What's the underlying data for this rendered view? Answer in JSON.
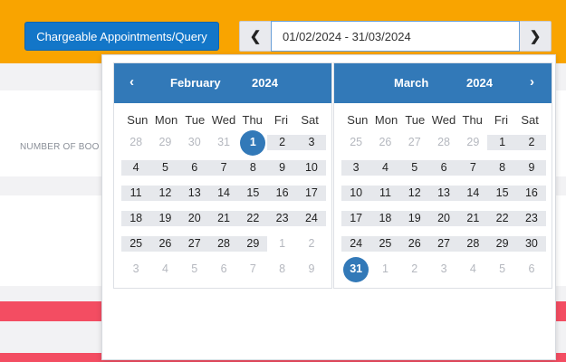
{
  "header": {
    "query_button": "Chargeable Appointments/Query",
    "date_range_value": "01/02/2024 - 31/03/2024",
    "prev_icon": "chevron-left-icon",
    "next_icon": "chevron-right-icon"
  },
  "background": {
    "column_label": "NUMBER OF BOO"
  },
  "colors": {
    "topbar": "#f9a400",
    "primary": "#1376c8",
    "calendar_header": "#3279b8",
    "range_fill": "#e6e8ec",
    "alert_bar": "#f34d62"
  },
  "calendar": {
    "weekdays": [
      "Sun",
      "Mon",
      "Tue",
      "Wed",
      "Thu",
      "Fri",
      "Sat"
    ],
    "left": {
      "month": "February",
      "year": "2024",
      "days": [
        {
          "d": "28",
          "t": "other"
        },
        {
          "d": "29",
          "t": "other"
        },
        {
          "d": "30",
          "t": "other"
        },
        {
          "d": "31",
          "t": "other"
        },
        {
          "d": "1",
          "t": "sel"
        },
        {
          "d": "2",
          "t": "in"
        },
        {
          "d": "3",
          "t": "in"
        },
        {
          "d": "4",
          "t": "in"
        },
        {
          "d": "5",
          "t": "in"
        },
        {
          "d": "6",
          "t": "in"
        },
        {
          "d": "7",
          "t": "in"
        },
        {
          "d": "8",
          "t": "in"
        },
        {
          "d": "9",
          "t": "in"
        },
        {
          "d": "10",
          "t": "in"
        },
        {
          "d": "11",
          "t": "in"
        },
        {
          "d": "12",
          "t": "in"
        },
        {
          "d": "13",
          "t": "in"
        },
        {
          "d": "14",
          "t": "in"
        },
        {
          "d": "15",
          "t": "in"
        },
        {
          "d": "16",
          "t": "in"
        },
        {
          "d": "17",
          "t": "in"
        },
        {
          "d": "18",
          "t": "in"
        },
        {
          "d": "19",
          "t": "in"
        },
        {
          "d": "20",
          "t": "in"
        },
        {
          "d": "21",
          "t": "in"
        },
        {
          "d": "22",
          "t": "in"
        },
        {
          "d": "23",
          "t": "in"
        },
        {
          "d": "24",
          "t": "in"
        },
        {
          "d": "25",
          "t": "in"
        },
        {
          "d": "26",
          "t": "in"
        },
        {
          "d": "27",
          "t": "in"
        },
        {
          "d": "28",
          "t": "in"
        },
        {
          "d": "29",
          "t": "in"
        },
        {
          "d": "1",
          "t": "other"
        },
        {
          "d": "2",
          "t": "other"
        },
        {
          "d": "3",
          "t": "other"
        },
        {
          "d": "4",
          "t": "other"
        },
        {
          "d": "5",
          "t": "other"
        },
        {
          "d": "6",
          "t": "other"
        },
        {
          "d": "7",
          "t": "other"
        },
        {
          "d": "8",
          "t": "other"
        },
        {
          "d": "9",
          "t": "other"
        }
      ]
    },
    "right": {
      "month": "March",
      "year": "2024",
      "days": [
        {
          "d": "25",
          "t": "other"
        },
        {
          "d": "26",
          "t": "other"
        },
        {
          "d": "27",
          "t": "other"
        },
        {
          "d": "28",
          "t": "other"
        },
        {
          "d": "29",
          "t": "other"
        },
        {
          "d": "1",
          "t": "in"
        },
        {
          "d": "2",
          "t": "in"
        },
        {
          "d": "3",
          "t": "in"
        },
        {
          "d": "4",
          "t": "in"
        },
        {
          "d": "5",
          "t": "in"
        },
        {
          "d": "6",
          "t": "in"
        },
        {
          "d": "7",
          "t": "in"
        },
        {
          "d": "8",
          "t": "in"
        },
        {
          "d": "9",
          "t": "in"
        },
        {
          "d": "10",
          "t": "in"
        },
        {
          "d": "11",
          "t": "in"
        },
        {
          "d": "12",
          "t": "in"
        },
        {
          "d": "13",
          "t": "in"
        },
        {
          "d": "14",
          "t": "in"
        },
        {
          "d": "15",
          "t": "in"
        },
        {
          "d": "16",
          "t": "in"
        },
        {
          "d": "17",
          "t": "in"
        },
        {
          "d": "18",
          "t": "in"
        },
        {
          "d": "19",
          "t": "in"
        },
        {
          "d": "20",
          "t": "in"
        },
        {
          "d": "21",
          "t": "in"
        },
        {
          "d": "22",
          "t": "in"
        },
        {
          "d": "23",
          "t": "in"
        },
        {
          "d": "24",
          "t": "in"
        },
        {
          "d": "25",
          "t": "in"
        },
        {
          "d": "26",
          "t": "in"
        },
        {
          "d": "27",
          "t": "in"
        },
        {
          "d": "28",
          "t": "in"
        },
        {
          "d": "29",
          "t": "in"
        },
        {
          "d": "30",
          "t": "in"
        },
        {
          "d": "31",
          "t": "sel"
        },
        {
          "d": "1",
          "t": "other"
        },
        {
          "d": "2",
          "t": "other"
        },
        {
          "d": "3",
          "t": "other"
        },
        {
          "d": "4",
          "t": "other"
        },
        {
          "d": "5",
          "t": "other"
        },
        {
          "d": "6",
          "t": "other"
        }
      ]
    }
  }
}
